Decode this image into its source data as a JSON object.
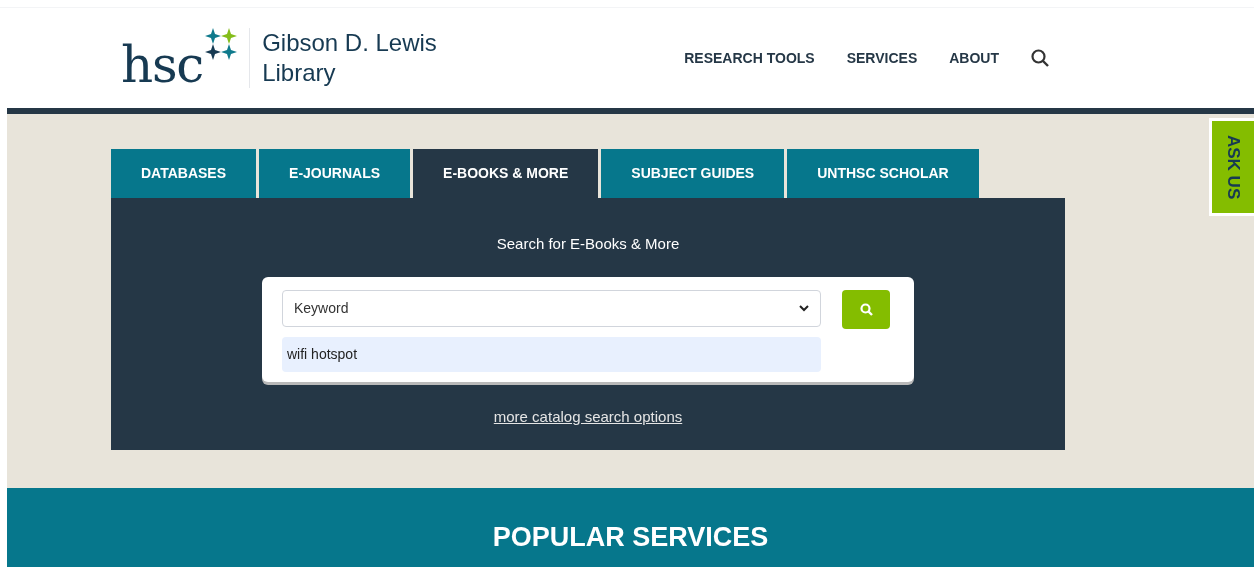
{
  "logo": {
    "mark": "hsc",
    "name_line_1": "Gibson D. Lewis",
    "name_line_2": "Library"
  },
  "nav": {
    "items": [
      "RESEARCH TOOLS",
      "SERVICES",
      "ABOUT"
    ]
  },
  "tabs": [
    {
      "label": "DATABASES",
      "selected": false
    },
    {
      "label": "E-JOURNALS",
      "selected": false
    },
    {
      "label": "E-BOOKS & MORE",
      "selected": true
    },
    {
      "label": "SUBJECT GUIDES",
      "selected": false
    },
    {
      "label": "UNTHSC SCHOLAR",
      "selected": false
    }
  ],
  "search": {
    "heading": "Search for E-Books & More",
    "search_type": "Keyword",
    "query": "wifi hotspot",
    "more_link": "more catalog search options"
  },
  "ask_us": "ASK US",
  "popular": {
    "heading": "POPULAR SERVICES"
  }
}
